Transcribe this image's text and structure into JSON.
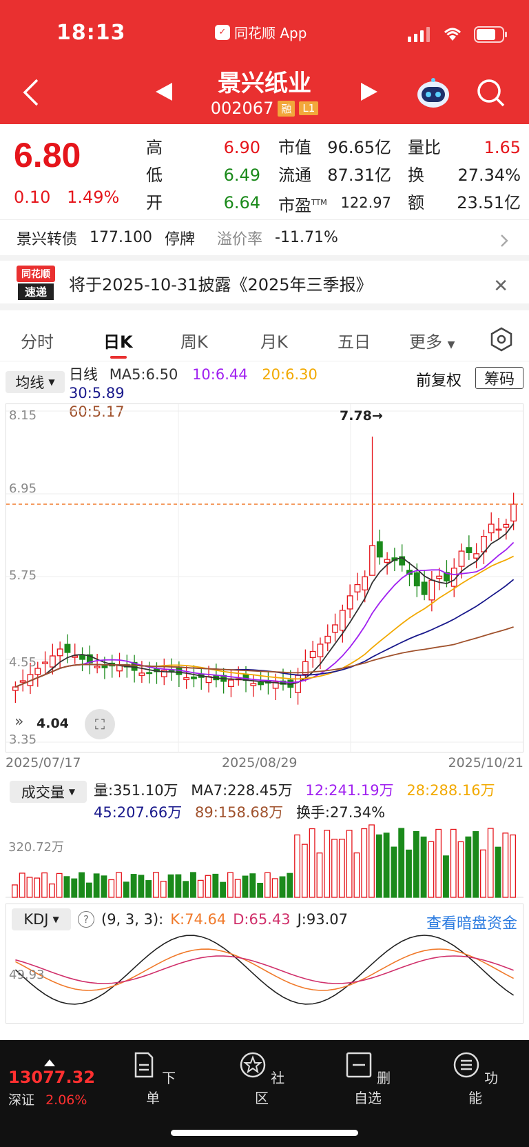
{
  "status_bar": {
    "time": "18:13",
    "app_name": "同花顺 App"
  },
  "header": {
    "stock_name": "景兴纸业",
    "stock_code": "002067",
    "tags": [
      "融",
      "L1"
    ]
  },
  "quote": {
    "price": "6.80",
    "change": "0.10",
    "change_pct": "1.49%",
    "high_label": "高",
    "high": "6.90",
    "low_label": "低",
    "low": "6.49",
    "open_label": "开",
    "open": "6.64",
    "mktcap_label": "市值",
    "mktcap": "96.65亿",
    "float_label": "流通",
    "float_cap": "87.31亿",
    "pe_label": "市盈",
    "pe_sup": "TTM",
    "pe": "122.97",
    "vr_label": "量比",
    "volume_ratio": "1.65",
    "turnover_label": "换",
    "turnover": "27.34%",
    "amount_label": "额",
    "amount": "23.51亿"
  },
  "bond": {
    "name": "景兴转债",
    "price": "177.100",
    "status": "停牌",
    "premium_label": "溢价率",
    "premium": "-11.71%"
  },
  "notice": {
    "logo_line1": "同花顺",
    "logo_line2": "速递",
    "text": "将于2025-10-31披露《2025年三季报》"
  },
  "tabs": [
    "分时",
    "日K",
    "周K",
    "月K",
    "五日",
    "更多"
  ],
  "ma": {
    "select_label": "均线",
    "line_label": "日线",
    "ma5": "MA5:6.50",
    "ma10": "10:6.44",
    "ma20": "20:6.30",
    "ma30": "30:5.89",
    "ma60": "60:5.17",
    "adjust": "前复权",
    "chip": "筹码"
  },
  "chart": {
    "y_labels": [
      "8.15",
      "6.95",
      "5.75",
      "4.55",
      "3.35"
    ],
    "peak_label": "7.78→",
    "left_label": "4.04",
    "x_labels": [
      "2025/07/17",
      "2025/08/29",
      "2025/10/21"
    ]
  },
  "volume": {
    "select_label": "成交量",
    "vol": "量:351.10万",
    "ma7": "MA7:228.45万",
    "ma12": "12:241.19万",
    "ma28": "28:288.16万",
    "ma45": "45:207.66万",
    "ma89": "89:158.68万",
    "turnover": "换手:27.34%",
    "axis_label": "320.72万"
  },
  "kdj": {
    "select_label": "KDJ",
    "params": "(9, 3, 3):",
    "k": "K:74.64",
    "d": "D:65.43",
    "j": "J:93.07",
    "link": "查看暗盘资金",
    "axis_label": "49.93"
  },
  "bottom": {
    "index_value": "13077.32",
    "index_name": "深证",
    "index_pct": "2.06%",
    "items": [
      "下单",
      "社区",
      "删自选",
      "功能"
    ]
  },
  "colors": {
    "header": "#e93030",
    "up": "#e5151b",
    "down": "#1b8a1b",
    "ma10": "#a020f0",
    "ma20": "#f2a900",
    "ma30": "#1a1a8c",
    "ma60": "#a0522d",
    "link": "#2b7be0"
  },
  "chart_data": {
    "type": "candlestick",
    "x_range": [
      "2025/07/17",
      "2025/10/21"
    ],
    "ylim": [
      3.35,
      8.15
    ],
    "series": [
      {
        "name": "MA5",
        "last": 6.5
      },
      {
        "name": "10",
        "last": 6.44
      },
      {
        "name": "20",
        "last": 6.3
      },
      {
        "name": "30",
        "last": 5.89
      },
      {
        "name": "60",
        "last": 5.17
      }
    ],
    "peak": 7.78,
    "last_close": 6.8
  }
}
